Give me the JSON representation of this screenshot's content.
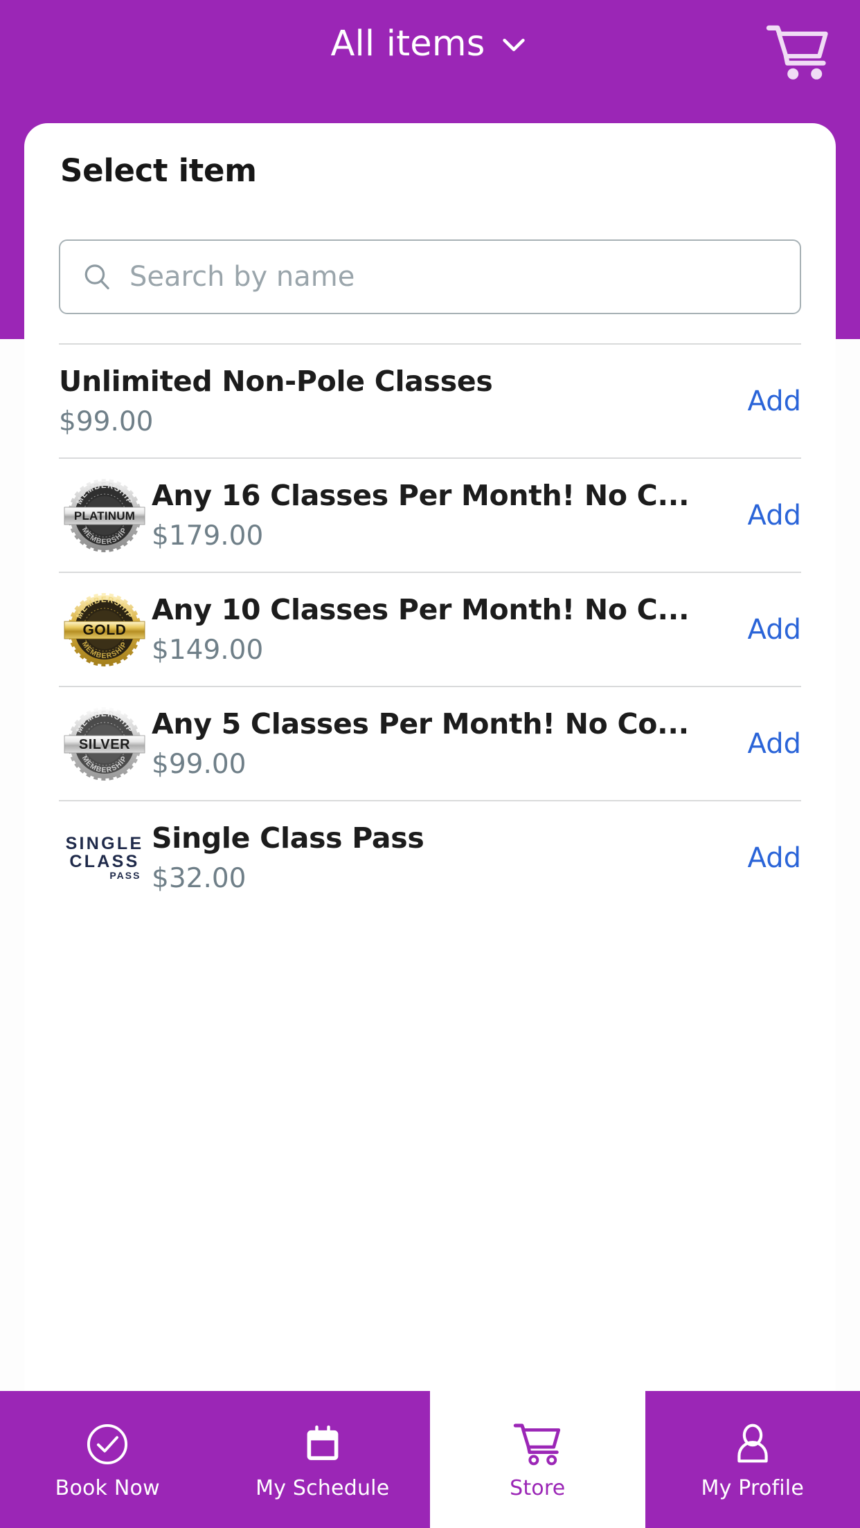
{
  "header": {
    "title": "All items",
    "dropdown_icon": "chevron-down-icon",
    "cart_icon": "shopping-cart-icon",
    "background_color": "#9B26B6"
  },
  "sheet": {
    "title": "Select item"
  },
  "search": {
    "icon": "search-icon",
    "placeholder": "Search by name",
    "value": ""
  },
  "list": {
    "action_label": "Add",
    "action_color": "#2a64d8",
    "items": [
      {
        "name": "Unlimited Non-Pole Classes",
        "price": "$99.00",
        "thumb": "none",
        "action": "Add"
      },
      {
        "name": "Any 16 Classes Per Month! No C...",
        "price": "$179.00",
        "thumb": "platinum-membership-badge",
        "thumb_text": "PLATINUM",
        "thumb_arc_text": "MEMBERSHIP",
        "action": "Add"
      },
      {
        "name": "Any 10 Classes Per Month! No C...",
        "price": "$149.00",
        "thumb": "gold-membership-badge",
        "thumb_text": "GOLD",
        "thumb_arc_text": "MEMBERSHIP",
        "action": "Add"
      },
      {
        "name": "Any 5 Classes Per Month! No Co...",
        "price": "$99.00",
        "thumb": "silver-membership-badge",
        "thumb_text": "SILVER",
        "thumb_arc_text": "MEMBERSHIP",
        "action": "Add"
      },
      {
        "name": "Single Class Pass",
        "price": "$32.00",
        "thumb": "single-class-pass-logo",
        "thumb_line1": "SINGLE",
        "thumb_line2": "CLASS",
        "thumb_line3": "PASS",
        "action": "Add"
      }
    ]
  },
  "bottom_nav": {
    "active": "Store",
    "items": [
      {
        "label": "Book Now",
        "icon": "check-circle-icon",
        "active": false
      },
      {
        "label": "My Schedule",
        "icon": "calendar-icon",
        "active": false
      },
      {
        "label": "Store",
        "icon": "shopping-cart-icon",
        "active": true
      },
      {
        "label": "My Profile",
        "icon": "person-icon",
        "active": false
      }
    ]
  }
}
